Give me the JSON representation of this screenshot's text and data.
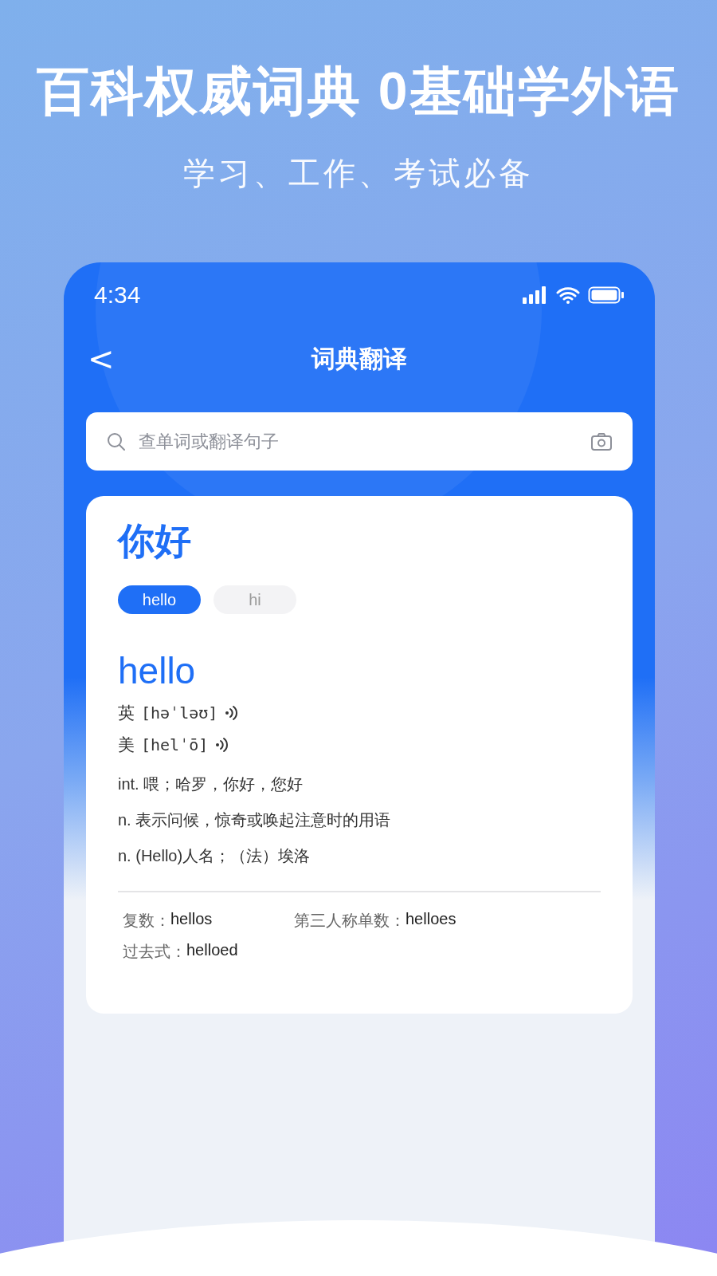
{
  "promo": {
    "headline": "百科权威词典 0基础学外语",
    "subtitle": "学习、工作、考试必备"
  },
  "status_bar": {
    "time": "4:34"
  },
  "nav": {
    "back": "<",
    "title": "词典翻译"
  },
  "search": {
    "placeholder": "查单词或翻译句子"
  },
  "entry": {
    "query": "你好",
    "tags": [
      {
        "label": "hello",
        "selected": true
      },
      {
        "label": "hi",
        "selected": false
      }
    ],
    "word": "hello",
    "pronunciations": [
      {
        "region": "英",
        "ipa": "[həˈləʊ]"
      },
      {
        "region": "美",
        "ipa": "[helˈō]"
      }
    ],
    "definitions": [
      "int. 喂；哈罗，你好，您好",
      "n. 表示问候，惊奇或唤起注意时的用语",
      "n. (Hello)人名；（法）埃洛"
    ],
    "forms": [
      {
        "label": "复数：",
        "value": "hellos"
      },
      {
        "label": "第三人称单数：",
        "value": "helloes"
      },
      {
        "label": "过去式：",
        "value": "helloed"
      }
    ]
  }
}
